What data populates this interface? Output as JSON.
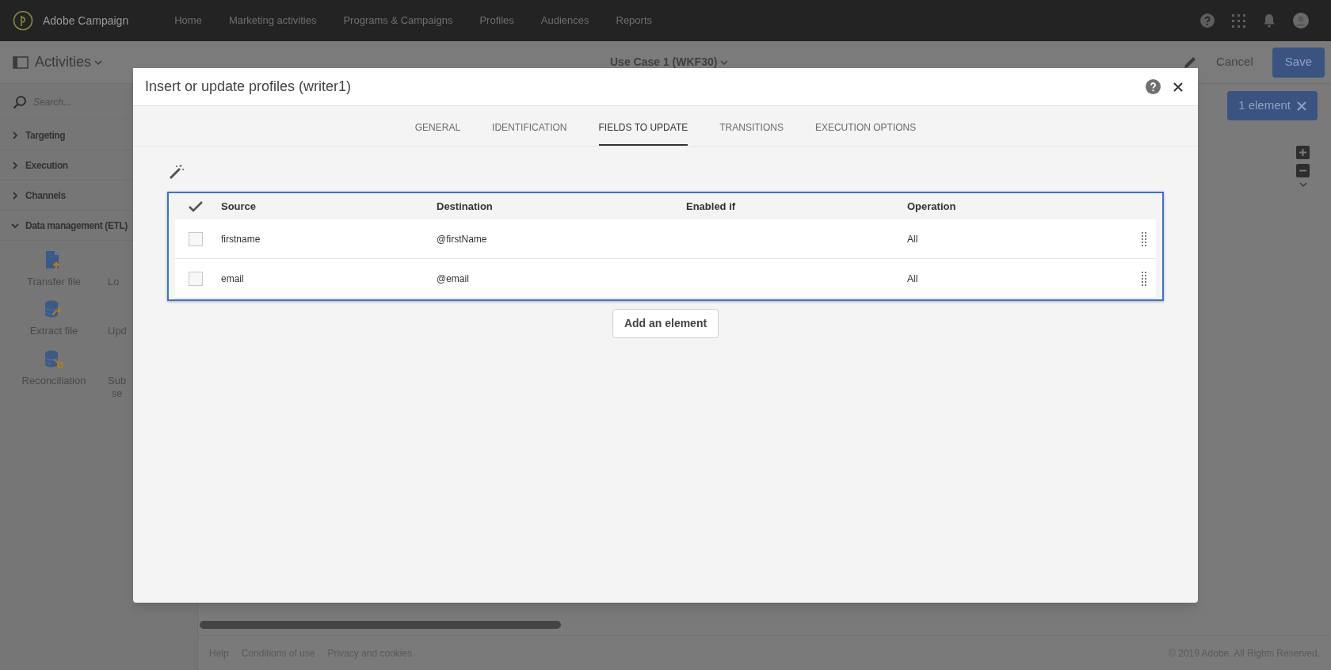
{
  "app": {
    "name": "Adobe Campaign"
  },
  "nav": [
    {
      "label": "Home"
    },
    {
      "label": "Marketing activities"
    },
    {
      "label": "Programs & Campaigns"
    },
    {
      "label": "Profiles"
    },
    {
      "label": "Audiences"
    },
    {
      "label": "Reports"
    }
  ],
  "header": {
    "activities": "Activities",
    "workflow_title": "Use Case 1 (WKF30)",
    "cancel": "Cancel",
    "save": "Save",
    "selection": "1 element"
  },
  "sidebar": {
    "search_placeholder": "Search...",
    "categories": [
      {
        "label": "Targeting",
        "expanded": false
      },
      {
        "label": "Execution",
        "expanded": false
      },
      {
        "label": "Channels",
        "expanded": false
      },
      {
        "label": "Data management (ETL)",
        "expanded": true
      }
    ],
    "activities": [
      {
        "label": "Transfer file",
        "kind": "upload"
      },
      {
        "label": "Lo"
      },
      {
        "label": "Extract file",
        "kind": "export"
      },
      {
        "label": "Upd"
      },
      {
        "label": "Reconciliation",
        "kind": "key"
      },
      {
        "label": "Sub\nse"
      }
    ]
  },
  "dialog": {
    "title": "Insert or update profiles (writer1)",
    "tabs": [
      {
        "label": "GENERAL",
        "selected": false
      },
      {
        "label": "IDENTIFICATION",
        "selected": false
      },
      {
        "label": "FIELDS TO UPDATE",
        "selected": true
      },
      {
        "label": "TRANSITIONS",
        "selected": false
      },
      {
        "label": "EXECUTION OPTIONS",
        "selected": false
      }
    ],
    "table": {
      "columns": [
        "Source",
        "Destination",
        "Enabled if",
        "Operation"
      ],
      "rows": [
        {
          "checked": false,
          "source": "firstname",
          "destination": "@firstName",
          "operation": "All"
        },
        {
          "checked": false,
          "source": "email",
          "destination": "@email",
          "operation": "All"
        }
      ]
    },
    "add_button": "Add an element"
  },
  "footer": {
    "links": [
      "Help",
      "Conditions of use",
      "Privacy and cookies"
    ],
    "copyright": "© 2019 Adobe. All Rights Reserved."
  }
}
